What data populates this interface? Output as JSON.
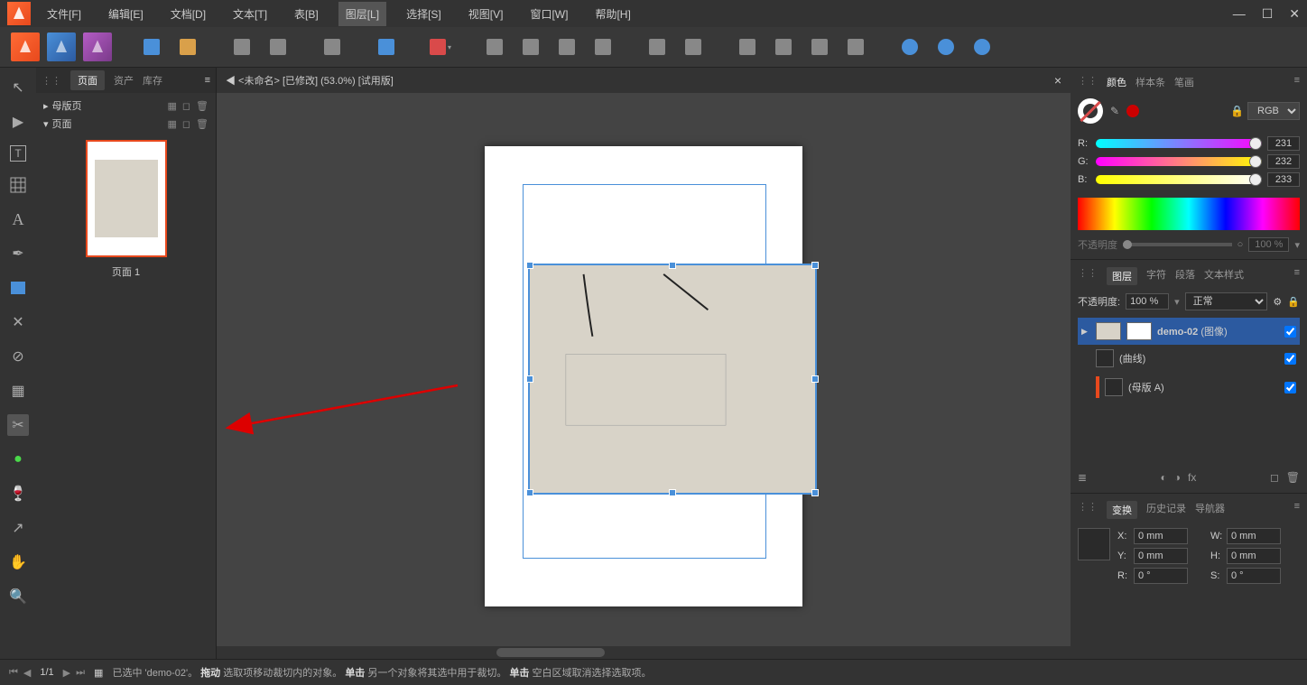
{
  "menu": {
    "file": "文件[F]",
    "edit": "编辑[E]",
    "document": "文档[D]",
    "text": "文本[T]",
    "table": "表[B]",
    "layer": "图层[L]",
    "select": "选择[S]",
    "view": "视图[V]",
    "window": "窗口[W]",
    "help": "帮助[H]"
  },
  "document_tab": "◀ <未命名> [已修改] (53.0%) [试用版]",
  "panels": {
    "pages_tabs": {
      "pages": "页面",
      "assets": "资产",
      "stock": "库存"
    },
    "master_pages": "母版页",
    "pages_label": "页面",
    "page1_label": "页面 1",
    "color_tabs": {
      "color": "颜色",
      "swatches": "样本条",
      "stroke": "笔画"
    },
    "color_mode": "RGB",
    "rgb": {
      "r_label": "R:",
      "g_label": "G:",
      "b_label": "B:",
      "r": "231",
      "g": "232",
      "b": "233"
    },
    "opacity_label": "不透明度",
    "opacity_val": "100 %",
    "layers_tabs": {
      "layers": "图层",
      "glyphs": "字符",
      "paragraph": "段落",
      "text_styles": "文本样式"
    },
    "layer_opacity_label": "不透明度:",
    "layer_opacity": "100 %",
    "blend_mode": "正常",
    "layer_items": [
      {
        "name": "demo-02",
        "type": "(图像)"
      },
      {
        "name": "",
        "type": "(曲线)"
      },
      {
        "name": "",
        "type": "(母版 A)"
      }
    ],
    "transform_tabs": {
      "transform": "变换",
      "history": "历史记录",
      "navigator": "导航器"
    },
    "transform": {
      "x_label": "X:",
      "y_label": "Y:",
      "w_label": "W:",
      "h_label": "H:",
      "r_label": "R:",
      "s_label": "S:",
      "x": "0 mm",
      "y": "0 mm",
      "w": "0 mm",
      "h": "0 mm",
      "r": "0 °",
      "s": "0 °"
    }
  },
  "status": {
    "page_count": "1/1",
    "selection": "已选中 'demo-02'。",
    "hint_drag": "拖动",
    "hint_drag_text": "选取项移动裁切内的对象。",
    "hint_click1": "单击",
    "hint_click1_text": "另一个对象将其选中用于裁切。",
    "hint_click2": "单击",
    "hint_click2_text": "空白区域取消选择选取项。"
  }
}
